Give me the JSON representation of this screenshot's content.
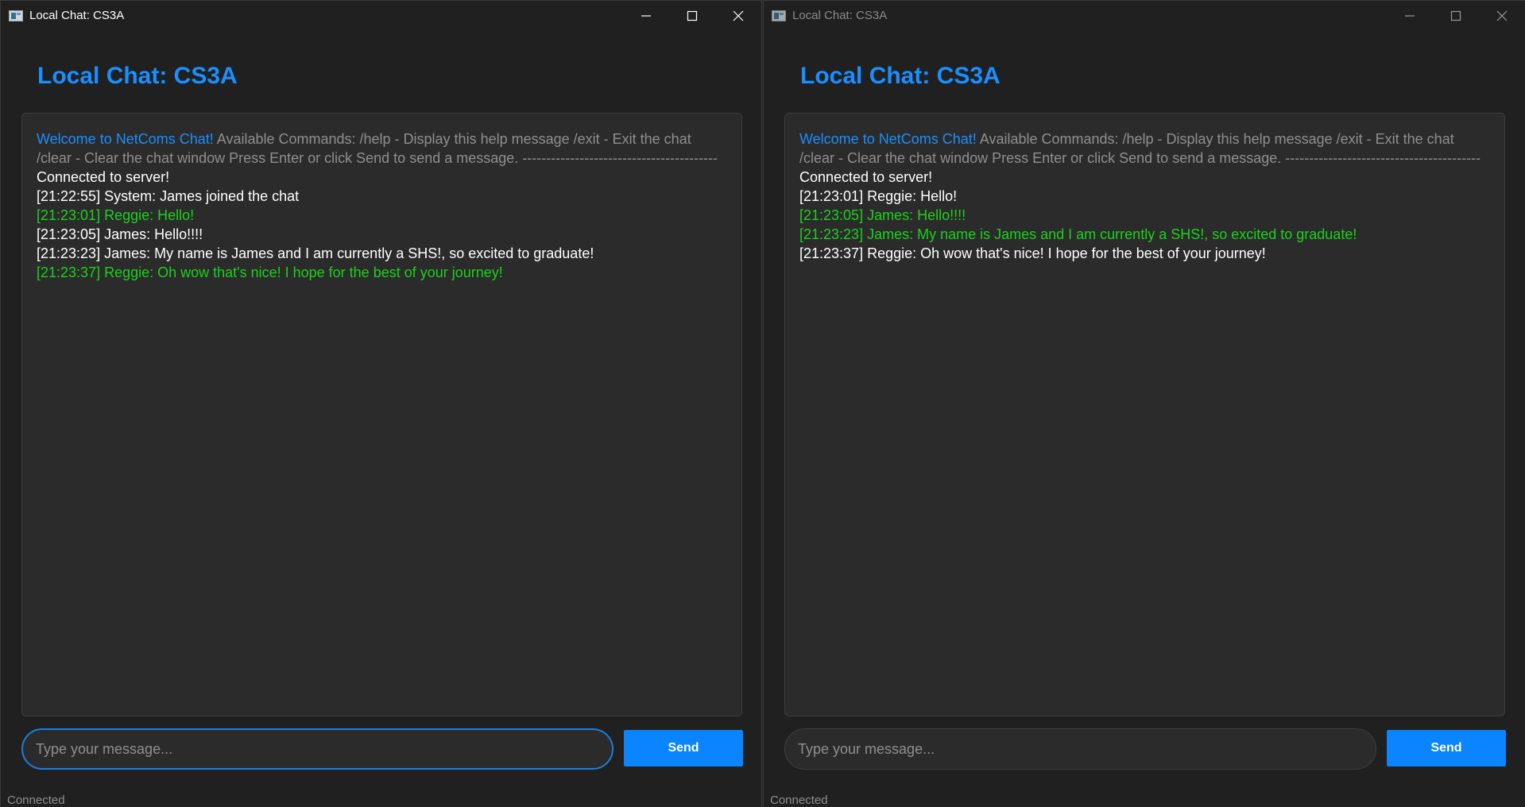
{
  "colors": {
    "accent": "#1a8fff",
    "background": "#202020",
    "panel": "#2b2b2b",
    "own_message": "#19d319",
    "send_button": "#0a84ff",
    "muted_text": "#8f8f8f"
  },
  "windows": [
    {
      "title": "Local Chat: CS3A",
      "heading": "Local Chat: CS3A",
      "welcome": {
        "title": "Welcome to NetComs Chat!",
        "body": " Available Commands: /help - Display this help message /exit - Exit the chat /clear - Clear the chat window Press Enter or click Send to send a message. -----------------------------------------"
      },
      "messages": [
        {
          "text": "Connected to server!",
          "style": "white"
        },
        {
          "text": "[21:22:55] System: James joined the chat",
          "style": "white"
        },
        {
          "text": "[21:23:01] Reggie: Hello!",
          "style": "green"
        },
        {
          "text": "[21:23:05] James: Hello!!!!",
          "style": "white"
        },
        {
          "text": "[21:23:23] James: My name is James and I am currently a SHS!, so excited to graduate!",
          "style": "white"
        },
        {
          "text": "[21:23:37] Reggie: Oh wow that's nice! I hope for the best of your journey!",
          "style": "green"
        }
      ],
      "input": {
        "placeholder": "Type your message...",
        "value": ""
      },
      "send_label": "Send",
      "status": "Connected",
      "active": true
    },
    {
      "title": "Local Chat: CS3A",
      "heading": "Local Chat: CS3A",
      "welcome": {
        "title": "Welcome to NetComs Chat!",
        "body": " Available Commands: /help - Display this help message /exit - Exit the chat /clear - Clear the chat window Press Enter or click Send to send a message. -----------------------------------------"
      },
      "messages": [
        {
          "text": "Connected to server!",
          "style": "white"
        },
        {
          "text": "[21:23:01] Reggie: Hello!",
          "style": "white"
        },
        {
          "text": "[21:23:05] James: Hello!!!!",
          "style": "green"
        },
        {
          "text": "[21:23:23] James: My name is James and I am currently a SHS!, so excited to graduate!",
          "style": "green"
        },
        {
          "text": "[21:23:37] Reggie: Oh wow that's nice! I hope for the best of your journey!",
          "style": "white"
        }
      ],
      "input": {
        "placeholder": "Type your message...",
        "value": ""
      },
      "send_label": "Send",
      "status": "Connected",
      "active": false
    }
  ]
}
